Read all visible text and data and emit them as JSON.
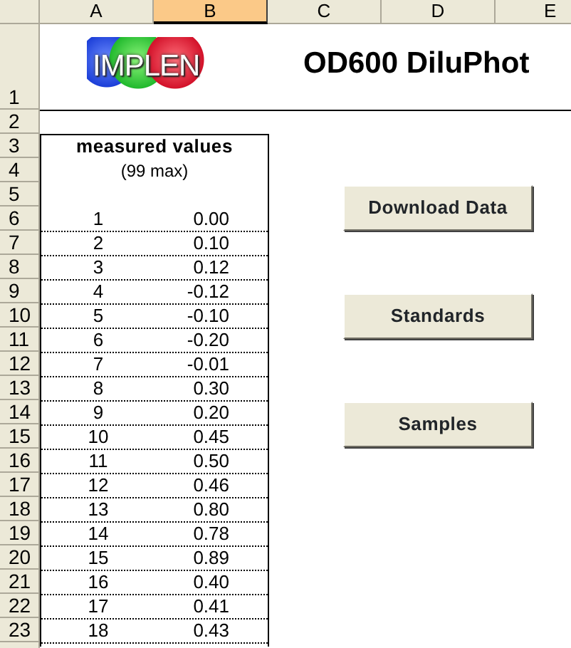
{
  "columns": [
    {
      "label": "A",
      "selected": false
    },
    {
      "label": "B",
      "selected": true
    },
    {
      "label": "C",
      "selected": false
    },
    {
      "label": "D",
      "selected": false
    },
    {
      "label": "E",
      "selected": false
    }
  ],
  "row_numbers": [
    "1",
    "2",
    "3",
    "4",
    "5",
    "6",
    "7",
    "8",
    "9",
    "10",
    "11",
    "12",
    "13",
    "14",
    "15",
    "16",
    "17",
    "18",
    "19",
    "20",
    "21",
    "22",
    "23"
  ],
  "logo": {
    "text": "IMPLEN"
  },
  "title": "OD600 DiluPhot",
  "table": {
    "heading": "measured values",
    "note": "(99 max)",
    "rows": [
      {
        "index": "1",
        "value": "0.00"
      },
      {
        "index": "2",
        "value": "0.10"
      },
      {
        "index": "3",
        "value": "0.12"
      },
      {
        "index": "4",
        "value": "-0.12"
      },
      {
        "index": "5",
        "value": "-0.10"
      },
      {
        "index": "6",
        "value": "-0.20"
      },
      {
        "index": "7",
        "value": "-0.01"
      },
      {
        "index": "8",
        "value": "0.30"
      },
      {
        "index": "9",
        "value": "0.20"
      },
      {
        "index": "10",
        "value": "0.45"
      },
      {
        "index": "11",
        "value": "0.50"
      },
      {
        "index": "12",
        "value": "0.46"
      },
      {
        "index": "13",
        "value": "0.80"
      },
      {
        "index": "14",
        "value": "0.78"
      },
      {
        "index": "15",
        "value": "0.89"
      },
      {
        "index": "16",
        "value": "0.40"
      },
      {
        "index": "17",
        "value": "0.41"
      },
      {
        "index": "18",
        "value": "0.43"
      }
    ]
  },
  "buttons": [
    "Download Data",
    "Standards",
    "Samples"
  ]
}
